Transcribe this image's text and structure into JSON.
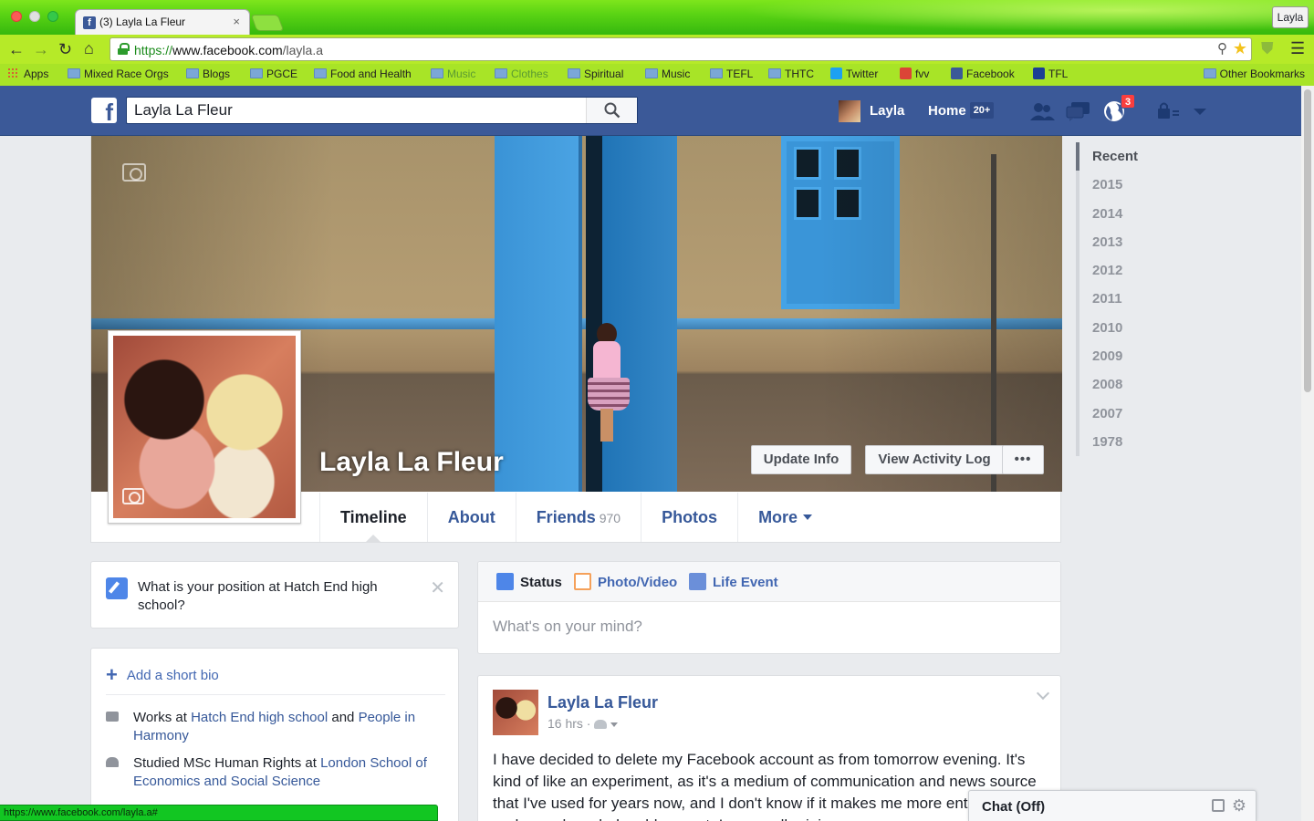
{
  "browser": {
    "tab_title": "(3) Layla La Fleur",
    "tab_close": "×",
    "profile_button": "Layla",
    "url_scheme": "https://",
    "url_host": "www.facebook.com",
    "url_path": "/layla.a",
    "bookmarks": [
      {
        "label": "Apps",
        "type": "apps"
      },
      {
        "label": "Mixed Race Orgs",
        "type": "folder"
      },
      {
        "label": "Blogs",
        "type": "folder"
      },
      {
        "label": "PGCE",
        "type": "folder"
      },
      {
        "label": "Food and Health",
        "type": "folder"
      },
      {
        "label": "Music",
        "type": "folder",
        "faded": true
      },
      {
        "label": "Clothes",
        "type": "folder",
        "faded": true
      },
      {
        "label": "Spiritual",
        "type": "folder"
      },
      {
        "label": "Music",
        "type": "folder"
      },
      {
        "label": "TEFL",
        "type": "folder"
      },
      {
        "label": "THTC",
        "type": "folder"
      },
      {
        "label": "Twitter",
        "type": "twitter"
      },
      {
        "label": "fvv",
        "type": "gmail"
      },
      {
        "label": "Facebook",
        "type": "facebook"
      },
      {
        "label": "TFL",
        "type": "tfl"
      }
    ],
    "bookmarks_overflow": "»",
    "other_bookmarks": "Other Bookmarks",
    "status_url": "https://www.facebook.com/layla.a#"
  },
  "fb_header": {
    "logo_letter": "f",
    "search_value": "Layla La Fleur",
    "user_name": "Layla",
    "home_label": "Home",
    "home_count": "20+",
    "notification_count": "3"
  },
  "profile": {
    "name": "Layla La Fleur",
    "update_info": "Update Info",
    "view_activity_log": "View Activity Log",
    "more_dots": "•••",
    "tabs": [
      {
        "label": "Timeline",
        "active": true
      },
      {
        "label": "About"
      },
      {
        "label": "Friends",
        "count": "970"
      },
      {
        "label": "Photos"
      },
      {
        "label": "More",
        "caret": true
      }
    ]
  },
  "years": [
    "Recent",
    "2015",
    "2014",
    "2013",
    "2012",
    "2011",
    "2010",
    "2009",
    "2008",
    "2007",
    "1978"
  ],
  "question": {
    "text": "What is your position at Hatch End high school?",
    "dismiss": "✕"
  },
  "intro": {
    "add_bio": "Add a short bio",
    "work_prefix": "Works at ",
    "work_place": "Hatch End high school",
    "work_and": " and ",
    "work_place2": "People in Harmony",
    "study_prefix": "Studied MSc Human Rights at ",
    "study_place": "London School of Economics and Social Science"
  },
  "composer": {
    "status": "Status",
    "photo_video": "Photo/Video",
    "life_event": "Life Event",
    "placeholder": "What's on your mind?"
  },
  "post": {
    "author": "Layla La Fleur",
    "time": "16 hrs ·",
    "body": "I have decided to delete my Facebook account as from tomorrow evening. It's kind of like an experiment, as it's a medium of communication and news source that I've used for years now, and I don't know if it makes me more entertained and more knowledgeable or not. I may well rejoin"
  },
  "chat": {
    "title": "Chat (Off)"
  },
  "colors": {
    "fb_blue": "#3b5998",
    "link": "#365899",
    "notification_red": "#fa3e3e",
    "chrome_green": "#5bd414"
  }
}
